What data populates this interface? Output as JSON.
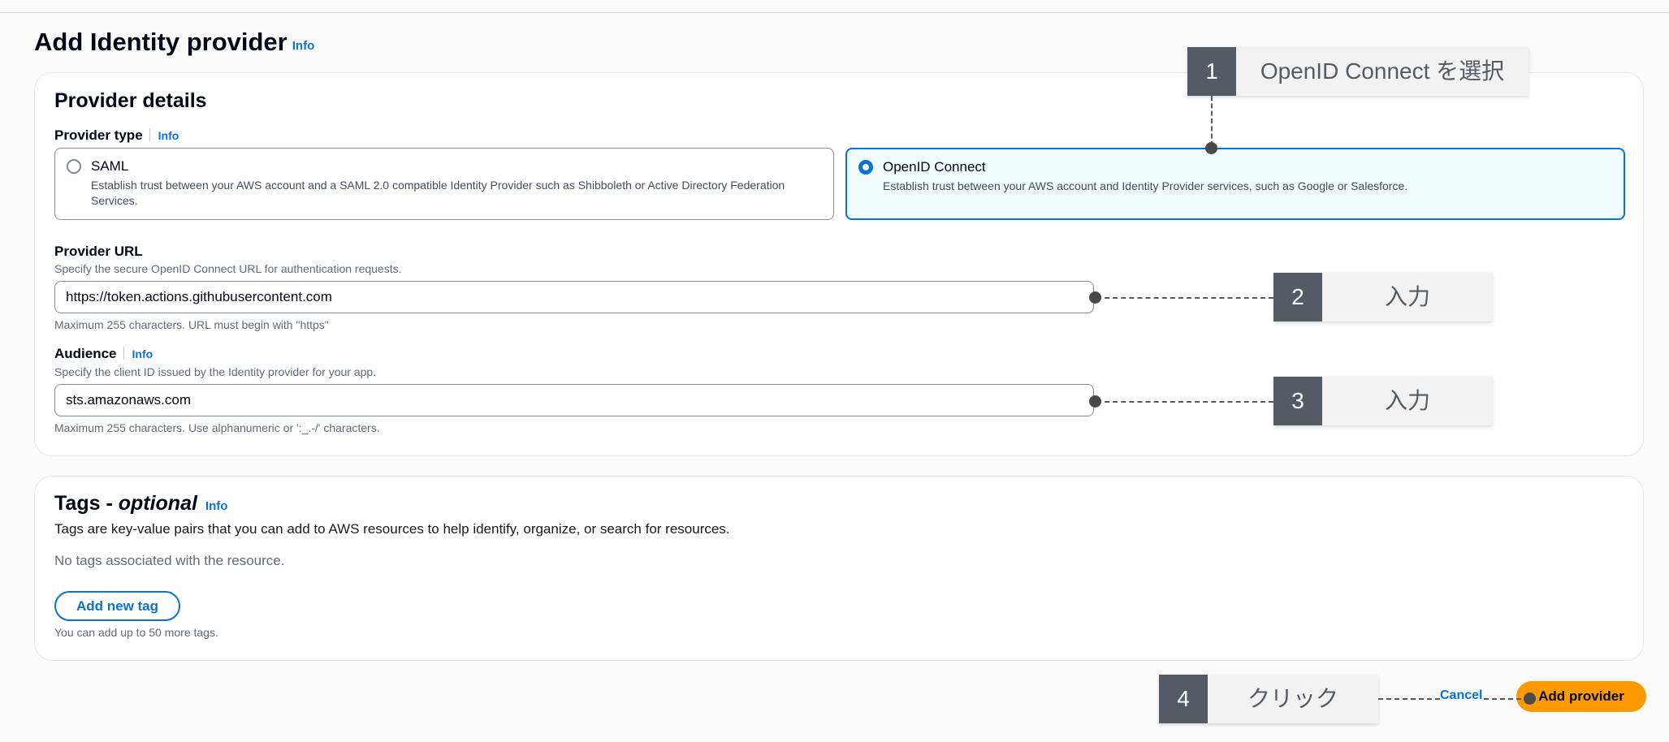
{
  "page": {
    "title": "Add Identity provider",
    "info_label": "Info"
  },
  "provider_details": {
    "heading": "Provider details",
    "provider_type_label": "Provider type",
    "info_label": "Info",
    "options": [
      {
        "label": "SAML",
        "description": "Establish trust between your AWS account and a SAML 2.0 compatible Identity Provider such as Shibboleth or Active Directory Federation Services.",
        "selected": false
      },
      {
        "label": "OpenID Connect",
        "description": "Establish trust between your AWS account and Identity Provider services, such as Google or Salesforce.",
        "selected": true
      }
    ],
    "provider_url": {
      "label": "Provider URL",
      "description": "Specify the secure OpenID Connect URL for authentication requests.",
      "value": "https://token.actions.githubusercontent.com",
      "constraint": "Maximum 255 characters. URL must begin with \"https\""
    },
    "audience": {
      "label": "Audience",
      "info_label": "Info",
      "description": "Specify the client ID issued by the Identity provider for your app.",
      "value": "sts.amazonaws.com",
      "constraint": "Maximum 255 characters. Use alphanumeric or ':_.-/' characters."
    }
  },
  "tags": {
    "heading_prefix": "Tags -",
    "heading_optional": "optional",
    "info_label": "Info",
    "description": "Tags are key-value pairs that you can add to AWS resources to help identify, organize, or search for resources.",
    "empty_text": "No tags associated with the resource.",
    "add_button": "Add new tag",
    "limit_text": "You can add up to 50 more tags."
  },
  "footer": {
    "cancel_label": "Cancel",
    "submit_label": "Add provider"
  },
  "annotations": [
    {
      "number": "1",
      "text": "OpenID Connect を選択"
    },
    {
      "number": "2",
      "text": "入力"
    },
    {
      "number": "3",
      "text": "入力"
    },
    {
      "number": "4",
      "text": "クリック"
    }
  ],
  "colors": {
    "accent": "#0972d3",
    "primary_button": "#ff9900",
    "annotation_dark": "#545b64",
    "annotation_light": "#f2f2f2"
  }
}
